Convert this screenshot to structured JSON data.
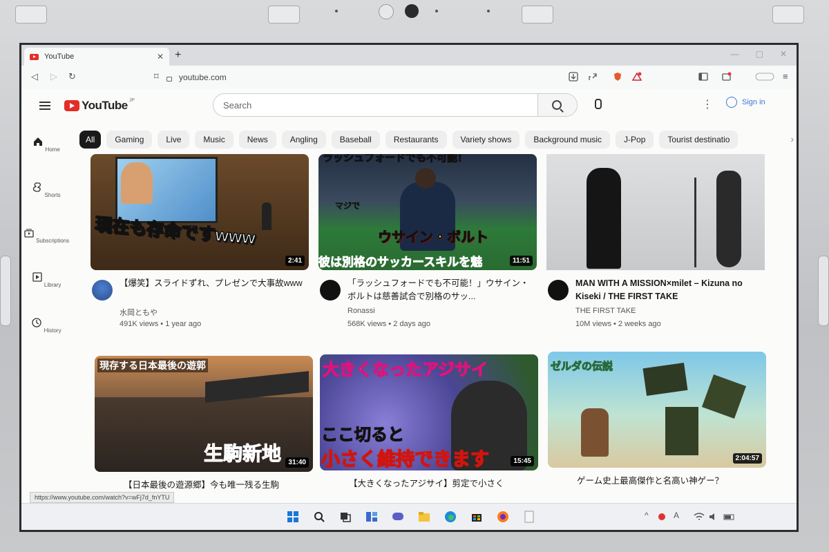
{
  "browser": {
    "tab_title": "YouTube",
    "tab_close": "✕",
    "new_tab": "+",
    "url": "youtube.com"
  },
  "youtube": {
    "logo_text": "YouTube",
    "country_code": "JP",
    "search_placeholder": "Search",
    "signin_label": "Sign in",
    "kebab": "⋮"
  },
  "guide": [
    {
      "label": "Home",
      "icon": "home-icon"
    },
    {
      "label": "Shorts",
      "icon": "shorts-icon"
    },
    {
      "label": "Subscriptions",
      "icon": "subscriptions-icon"
    },
    {
      "label": "Library",
      "icon": "library-icon"
    },
    {
      "label": "History",
      "icon": "history-icon"
    }
  ],
  "chips": [
    "All",
    "Gaming",
    "Live",
    "Music",
    "News",
    "Angling",
    "Baseball",
    "Restaurants",
    "Variety shows",
    "Background music",
    "J-Pop",
    "Tourist destinatio"
  ],
  "videos": [
    {
      "title": "【爆笑】スライドずれ、プレゼンで大事故www",
      "channel": "水岡ともや",
      "views": "491K views • 1 year ago",
      "duration": "2:41",
      "overlay": "現在も存命ですwww"
    },
    {
      "title": "「ラッシュフォードでも不可能！」ウサイン・ボルトは慈善試合で別格のサッ...",
      "channel": "Ronassi",
      "views": "568K views • 2 days ago",
      "duration": "11:51",
      "overlay_top": "ラッシュフォードでも不可能！",
      "overlay_mid": "ウサイン・ボルト",
      "overlay_tag": "マジで",
      "overlay": "彼は別格のサッカースキルを魅"
    },
    {
      "title": "MAN WITH A MISSION×milet – Kizuna no Kiseki / THE FIRST TAKE",
      "channel": "THE FIRST TAKE",
      "views": "10M views • 2 weeks ago",
      "duration": ""
    },
    {
      "title": "【日本最後の遊源郷】今も唯一残る生駒",
      "channel": "",
      "views": "",
      "duration": "31:40",
      "overlay_top": "現存する日本最後の遊郭",
      "overlay": "生駒新地"
    },
    {
      "title": "【大きくなったアジサイ】剪定で小さく",
      "channel": "",
      "views": "",
      "duration": "15:45",
      "overlay_top": "大きくなったアジサイ",
      "overlay_mid": "ここ切ると",
      "overlay": "小さく維持できます"
    },
    {
      "title": "ゲーム史上最高傑作と名高い神ゲー？",
      "channel": "",
      "views": "",
      "duration": "2:04:57",
      "overlay_top": "ゼルダの伝説"
    }
  ],
  "status_url": "https://www.youtube.com/watch?v=wFj7d_fnYTU",
  "colors": {
    "youtube_red": "#e52d27",
    "link_blue": "#3a76d6"
  }
}
